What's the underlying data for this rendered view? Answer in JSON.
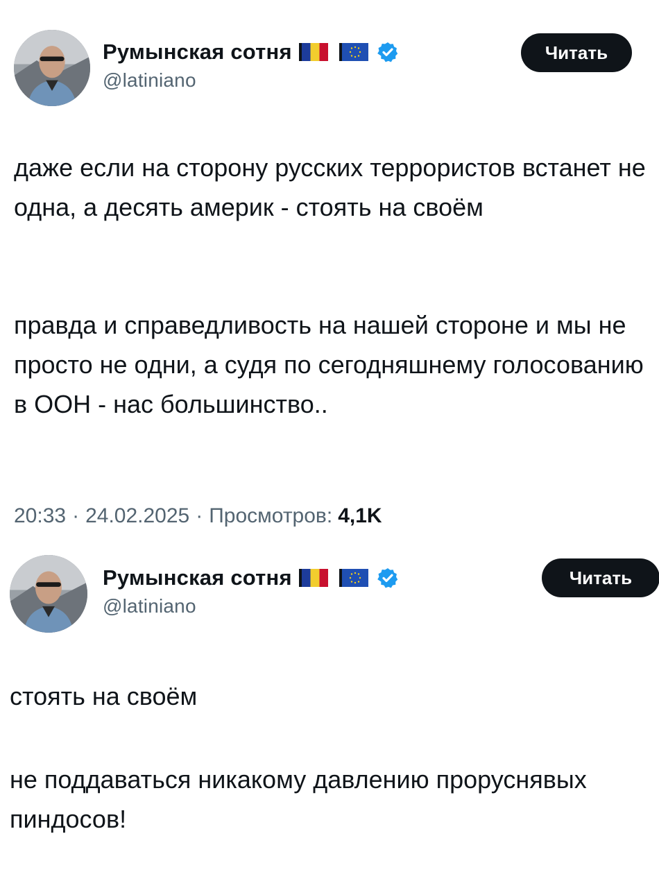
{
  "tweets": [
    {
      "author": {
        "display_name": "Румынская сотня",
        "handle": "@latiniano",
        "flags": [
          "flag-romania-icon",
          "flag-eu-icon"
        ],
        "verified": true
      },
      "follow_label": "Читать",
      "paragraphs": [
        "даже если на сторону русских террористов встанет не одна, а десять америк - стоять на своём",
        "правда и справедливость на нашей стороне и мы не просто не одни, а судя по сегодняшнему голосованию в ООН - нас большинство.."
      ],
      "time": "20:33",
      "date": "24.02.2025",
      "views_label": "Просмотров:",
      "views_count": "4,1K"
    },
    {
      "author": {
        "display_name": "Румынская сотня",
        "handle": "@latiniano",
        "flags": [
          "flag-romania-icon",
          "flag-eu-icon"
        ],
        "verified": true
      },
      "follow_label": "Читать",
      "paragraphs": [
        "стоять на своём",
        "не поддаваться никакому давлению проруснявых пиндосов!"
      ]
    }
  ],
  "colors": {
    "text": "#0f1419",
    "secondary": "#536471",
    "verified": "#1d9bf0",
    "button_bg": "#0f1419",
    "button_text": "#ffffff"
  }
}
